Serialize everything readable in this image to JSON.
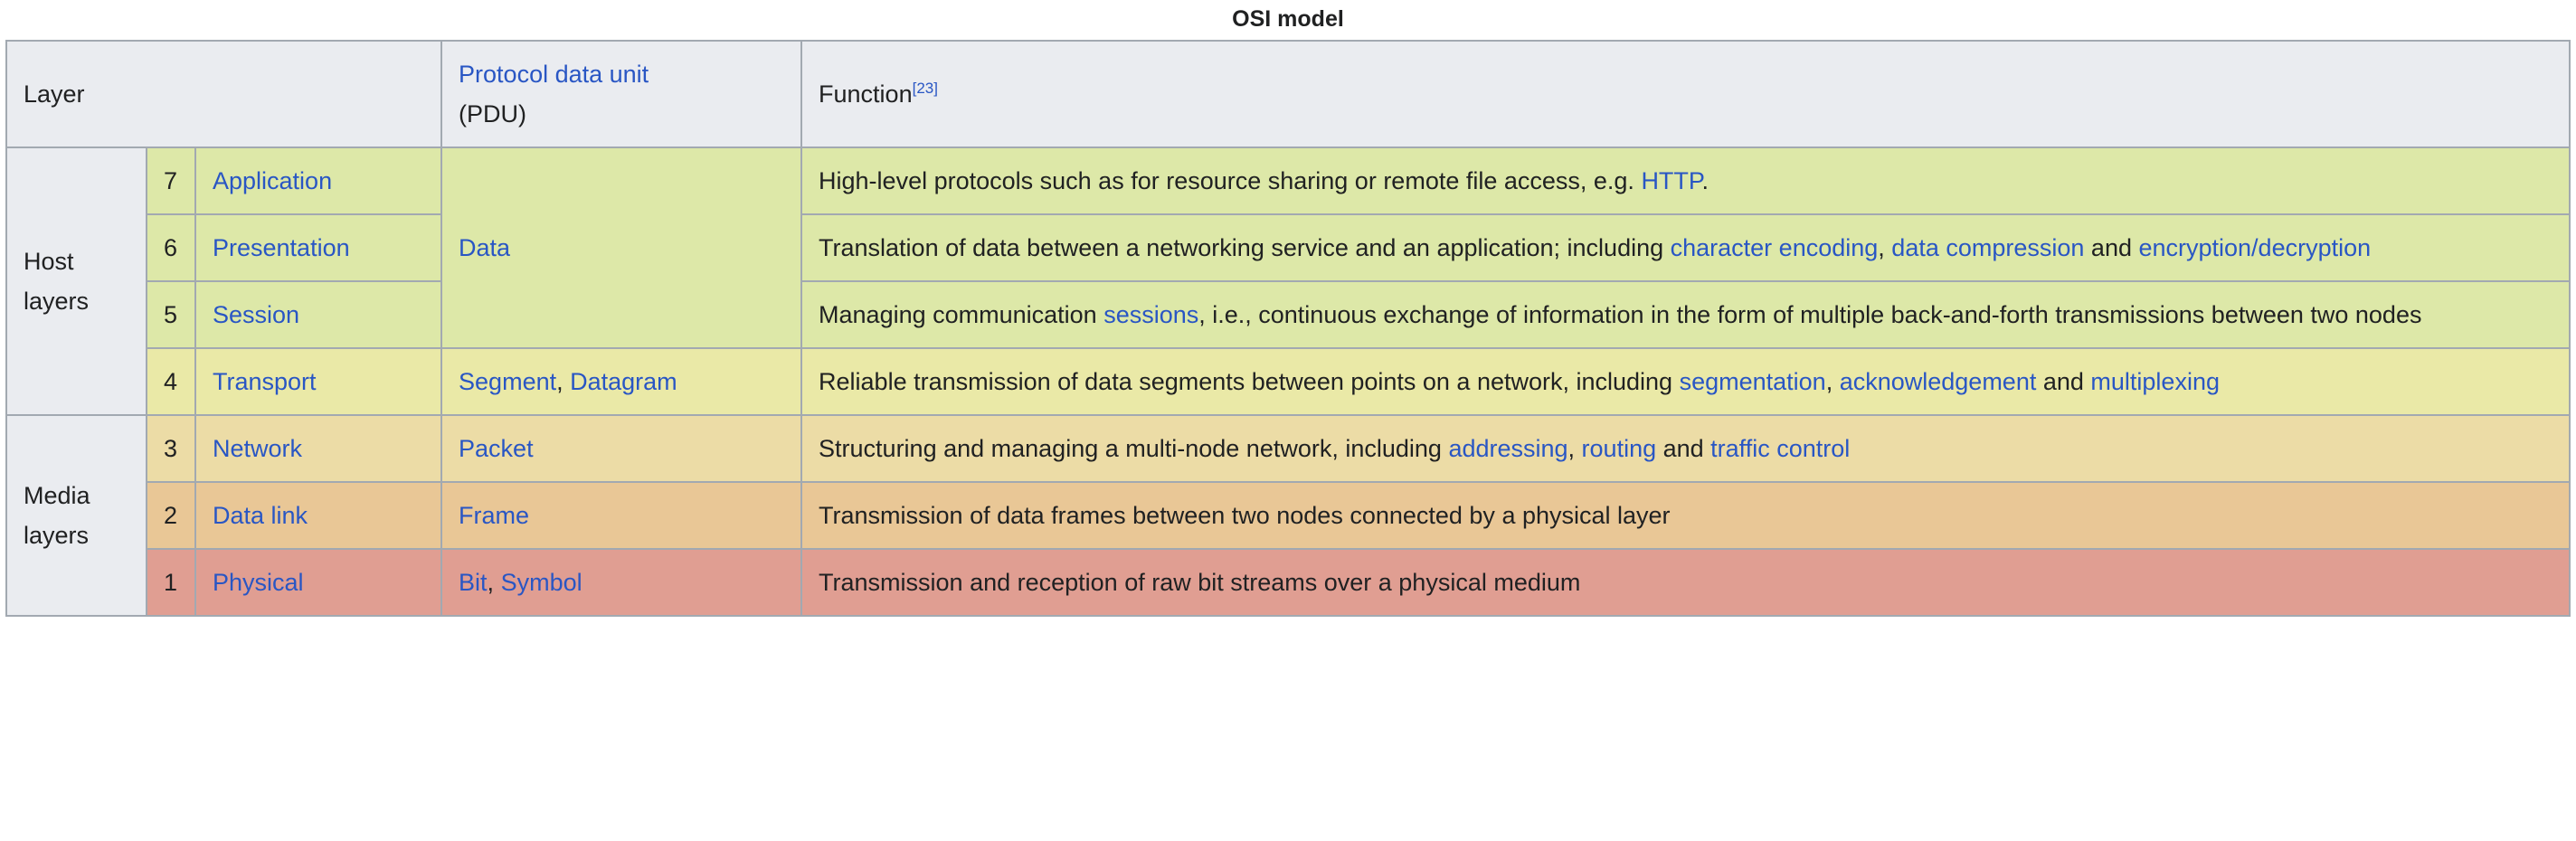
{
  "caption": "OSI model",
  "accent_link_color": "#2956c4",
  "header": {
    "layer": "Layer",
    "pdu_link": "Protocol data unit",
    "pdu_abbrev": "(PDU)",
    "function": "Function",
    "function_ref": "[23]"
  },
  "groups": {
    "host": "Host layers",
    "media": "Media layers"
  },
  "rows": [
    {
      "number": "7",
      "name": "Application",
      "color": "#dde8a8",
      "function_parts": [
        {
          "text": "High-level protocols such as for resource sharing or remote file access, e.g. ",
          "link": false
        },
        {
          "text": "HTTP",
          "link": true
        },
        {
          "text": ".",
          "link": false
        }
      ]
    },
    {
      "number": "6",
      "name": "Presentation",
      "color": "#dde8a8",
      "function_parts": [
        {
          "text": "Translation of data between a networking service and an application; including ",
          "link": false
        },
        {
          "text": "character encoding",
          "link": true
        },
        {
          "text": ", ",
          "link": false
        },
        {
          "text": "data compression",
          "link": true
        },
        {
          "text": " and ",
          "link": false
        },
        {
          "text": "encryption/decryption",
          "link": true
        }
      ]
    },
    {
      "number": "5",
      "name": "Session",
      "color": "#dde8a8",
      "function_parts": [
        {
          "text": "Managing communication ",
          "link": false
        },
        {
          "text": "sessions",
          "link": true
        },
        {
          "text": ", i.e., continuous exchange of information in the form of multiple back-and-forth transmissions between two nodes",
          "link": false
        }
      ]
    },
    {
      "number": "4",
      "name": "Transport",
      "color": "#eae9a7",
      "function_parts": [
        {
          "text": "Reliable transmission of data segments between points on a network, including ",
          "link": false
        },
        {
          "text": "segmentation",
          "link": true
        },
        {
          "text": ", ",
          "link": false
        },
        {
          "text": "acknowledgement",
          "link": true
        },
        {
          "text": " and ",
          "link": false
        },
        {
          "text": "multiplexing",
          "link": true
        }
      ]
    },
    {
      "number": "3",
      "name": "Network",
      "color": "#ecdca6",
      "function_parts": [
        {
          "text": "Structuring and managing a multi-node network, including ",
          "link": false
        },
        {
          "text": "addressing",
          "link": true
        },
        {
          "text": ", ",
          "link": false
        },
        {
          "text": "routing",
          "link": true
        },
        {
          "text": " and ",
          "link": false
        },
        {
          "text": "traffic control",
          "link": true
        }
      ]
    },
    {
      "number": "2",
      "name": "Data link",
      "color": "#e9c796",
      "function_parts": [
        {
          "text": "Transmission of data frames between two nodes connected by a physical layer",
          "link": false
        }
      ]
    },
    {
      "number": "1",
      "name": "Physical",
      "color": "#e09e92",
      "function_parts": [
        {
          "text": "Transmission and reception of raw bit streams over a physical medium",
          "link": false
        }
      ]
    }
  ],
  "pdu_cells": [
    {
      "for_layers": "7-5",
      "color": "#dde8a8",
      "parts": [
        {
          "text": "Data",
          "link": true
        }
      ]
    },
    {
      "for_layers": "4",
      "color": "#eae9a7",
      "parts": [
        {
          "text": "Segment",
          "link": true
        },
        {
          "text": ", ",
          "link": false
        },
        {
          "text": "Datagram",
          "link": true
        }
      ]
    },
    {
      "for_layers": "3",
      "color": "#ecdca6",
      "parts": [
        {
          "text": "Packet",
          "link": true
        }
      ]
    },
    {
      "for_layers": "2",
      "color": "#e9c796",
      "parts": [
        {
          "text": "Frame",
          "link": true
        }
      ]
    },
    {
      "for_layers": "1",
      "color": "#e09e92",
      "parts": [
        {
          "text": "Bit",
          "link": true
        },
        {
          "text": ", ",
          "link": false
        },
        {
          "text": "Symbol",
          "link": true
        }
      ]
    }
  ]
}
